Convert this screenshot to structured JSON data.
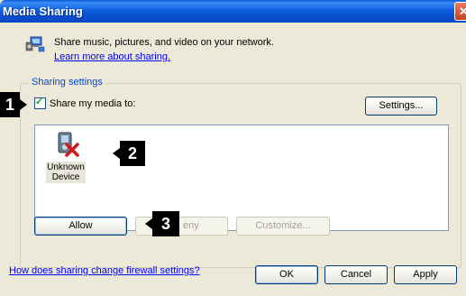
{
  "window": {
    "title": "Media Sharing",
    "close_glyph": "✕"
  },
  "header": {
    "description": "Share music, pictures, and video on your network.",
    "learn_more": "Learn more about sharing."
  },
  "sharing_settings": {
    "label": "Sharing settings",
    "share_checkbox_label": "Share my media to:",
    "share_checked": true,
    "settings_button": "Settings..."
  },
  "devices": [
    {
      "label_line1": "Unknown",
      "label_line2": "Device",
      "icon": "media-device-blocked-icon"
    }
  ],
  "actions": {
    "allow": "Allow",
    "deny": "Deny",
    "deny_visible_part": "eny",
    "customize": "Customize..."
  },
  "footer": {
    "firewall_link": "How does sharing change firewall settings?",
    "ok": "OK",
    "cancel": "Cancel",
    "apply": "Apply"
  },
  "callouts": [
    "1",
    "2",
    "3"
  ],
  "colors": {
    "titlebar": "#0a4fd0",
    "dialog_bg": "#ece9d8",
    "link": "#0000ee",
    "group_label": "#0046d5",
    "callout_bg": "#000000"
  }
}
